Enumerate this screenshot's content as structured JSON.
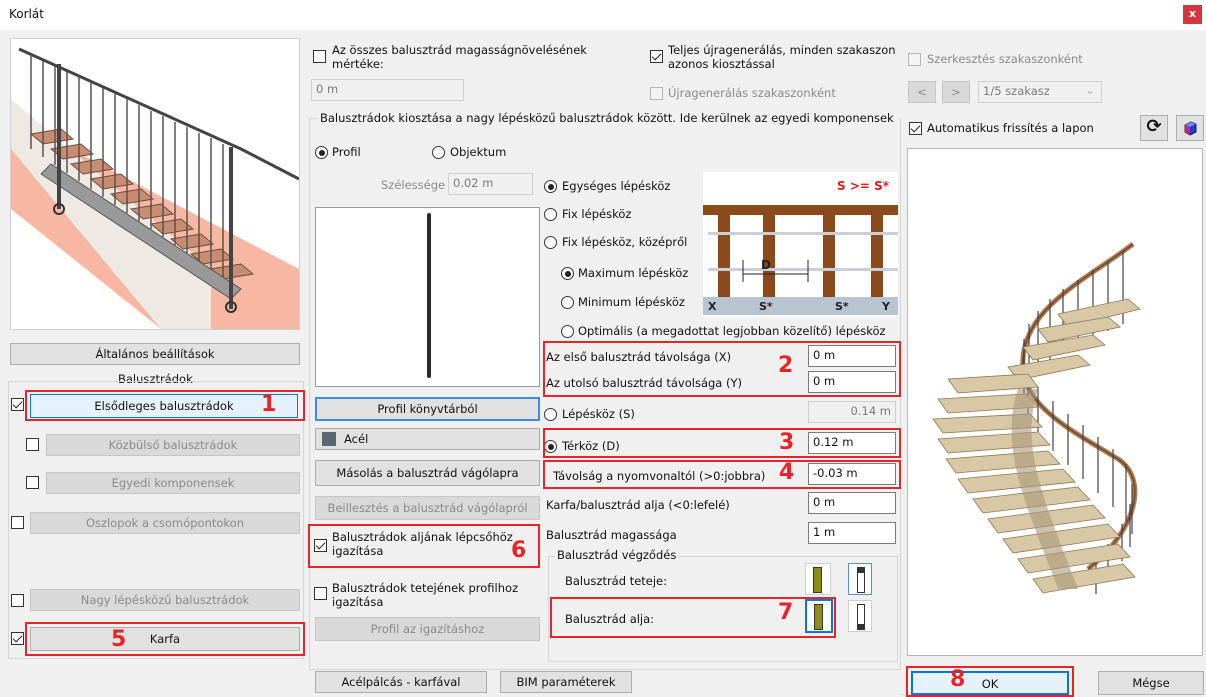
{
  "window": {
    "title": "Korlát",
    "close": "x"
  },
  "left": {
    "general_settings": "Általános beállítások",
    "balusters_header": "Balusztrádok",
    "primary": "Elsődleges balusztrádok",
    "intermediate": "Közbülső balusztrádok",
    "custom": "Egyedi komponensek",
    "posts": "Oszlopok a csomópontokon",
    "large_step": "Nagy lépésközű balusztrádok",
    "handrail": "Karfa"
  },
  "top": {
    "height_increase_label": "Az összes balusztrád magasságnövelésének mértéke:",
    "height_increase_value": "0 m",
    "full_regen": "Teljes újragenerálás, minden szakaszon azonos kiosztással",
    "regen_by_section": "Újragenerálás szakaszonként",
    "edit_by_section": "Szerkesztés szakaszonként",
    "prev": "<",
    "next": ">",
    "section_select": "1/5 szakasz"
  },
  "distribution": {
    "group_title": "Balusztrádok kiosztása a nagy lépésközű balusztrádok között. Ide kerülnek az egyedi komponensek",
    "profil": "Profil",
    "objektum": "Objektum",
    "width_label": "Szélessége",
    "width_value": "0.02 m",
    "uniform": "Egységes lépésköz",
    "fixed": "Fix lépésköz",
    "fixed_center": "Fix lépésköz, középről",
    "max": "Maximum lépésköz",
    "min": "Minimum lépésköz",
    "optimal": "Optimális (a megadottat legjobban közelítő) lépésköz",
    "first_dist_label": "Az első balusztrád távolsága (X)",
    "first_dist_value": "0 m",
    "last_dist_label": "Az utolsó balusztrád távolsága (Y)",
    "last_dist_value": "0 m",
    "step_label": "Lépésköz (S)",
    "step_value": "0.14 m",
    "gap_label": "Térköz (D)",
    "gap_value": "0.12 m",
    "offset_label": "Távolság a nyomvonaltól (>0:jobbra)",
    "offset_value": "-0.03 m",
    "bottom_label": "Karfa/balusztrád alja (<0:lefelé)",
    "bottom_value": "0 m",
    "height_label": "Balusztrád magassága",
    "height_value": "1 m",
    "ending_title": "Balusztrád végződés",
    "top_end": "Balusztrád teteje:",
    "bottom_end": "Balusztrád alja:"
  },
  "diagram": {
    "formula": "S >= S*",
    "d": "D",
    "x": "X",
    "s1": "S*",
    "s2": "S*",
    "y": "Y"
  },
  "profile_actions": {
    "from_library": "Profil könyvtárból",
    "material": "Acél",
    "copy": "Másolás a balusztrád vágólapra",
    "paste": "Beillesztés a balusztrád vágólapról",
    "align_bottom": "Balusztrádok aljának lépcsőhöz igazítása",
    "align_top": "Balusztrádok tetejének profilhoz igazítása",
    "profile_align": "Profil az igazításhoz"
  },
  "right": {
    "auto_refresh": "Automatikus frissítés a lapon"
  },
  "footer": {
    "steel_rod": "Acélpálcás - karfával",
    "bim": "BIM paraméterek",
    "ok": "OK",
    "cancel": "Mégse"
  },
  "markers": {
    "m1": "1",
    "m2": "2",
    "m3": "3",
    "m4": "4",
    "m5": "5",
    "m6": "6",
    "m7": "7",
    "m8": "8"
  },
  "colors": {
    "marker_red": "#e5252a",
    "focus_blue": "#0078d7"
  }
}
